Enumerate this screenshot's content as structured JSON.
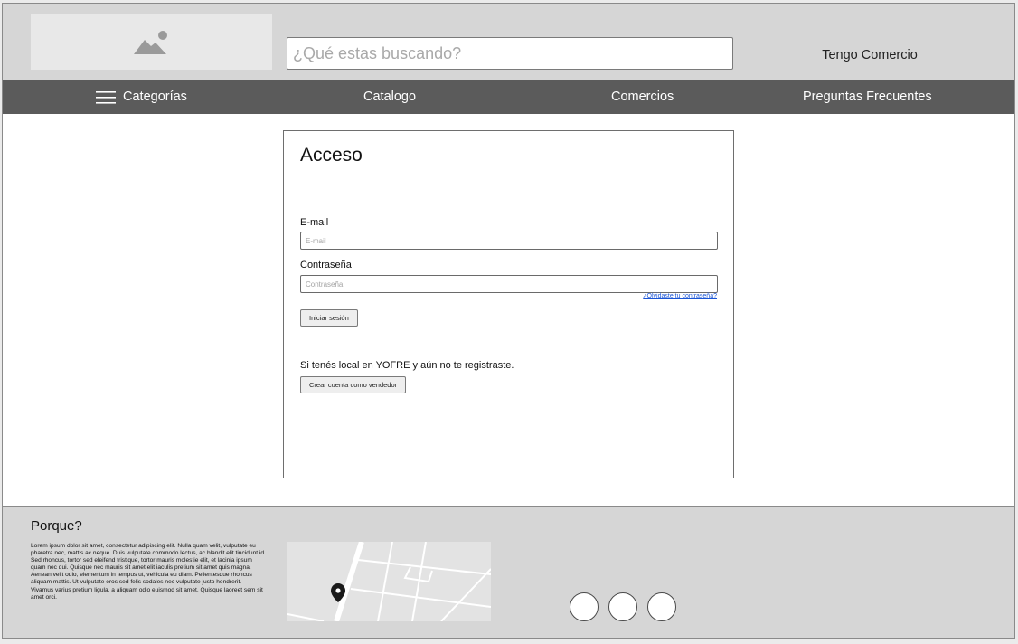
{
  "header": {
    "search_placeholder": "¿Qué estas buscando?",
    "tengo_comercio": "Tengo Comercio"
  },
  "nav": {
    "categorias": "Categorías",
    "catalogo": "Catalogo",
    "comercios": "Comercios",
    "preguntas": "Preguntas Frecuentes"
  },
  "login": {
    "title": "Acceso",
    "email_label": "E-mail",
    "email_placeholder": "E-mail",
    "password_label": "Contraseña",
    "password_placeholder": "Contraseña",
    "forgot_link": "¿Olvidaste tu contraseña?",
    "login_button": "Iniciar sesión",
    "seller_text": "Si tenés local en YOFRE y aún no te registraste.",
    "seller_button": "Crear cuenta como vendedor"
  },
  "footer": {
    "title": "Porque?",
    "body": "Lorem ipsum dolor sit amet, consectetur adipiscing elit. Nulla quam velit, vulputate eu pharetra nec, mattis ac neque. Duis vulputate commodo lectus, ac blandit elit tincidunt id. Sed rhoncus, tortor sed eleifend tristique, tortor mauris molestie elit, et lacinia ipsum quam nec dui. Quisque nec mauris sit amet elit iaculis pretium sit amet quis magna. Aenean velit odio, elementum in tempus ut, vehicula eu diam. Pellentesque rhoncus aliquam mattis. Ut vulputate eros sed felis sodales nec vulputate justo hendrerit. Vivamus varius pretium ligula, a aliquam odio euismod sit amet. Quisque laoreet sem sit amet orci."
  },
  "icons": {
    "logo": "image-placeholder-icon",
    "menu": "hamburger-menu-icon",
    "map_pin": "map-pin-icon",
    "social": [
      "social-icon-1",
      "social-icon-2",
      "social-icon-3"
    ]
  },
  "colors": {
    "header_bg": "#d6d6d6",
    "nav_bg": "#5b5b5b",
    "link": "#1a55d6"
  }
}
